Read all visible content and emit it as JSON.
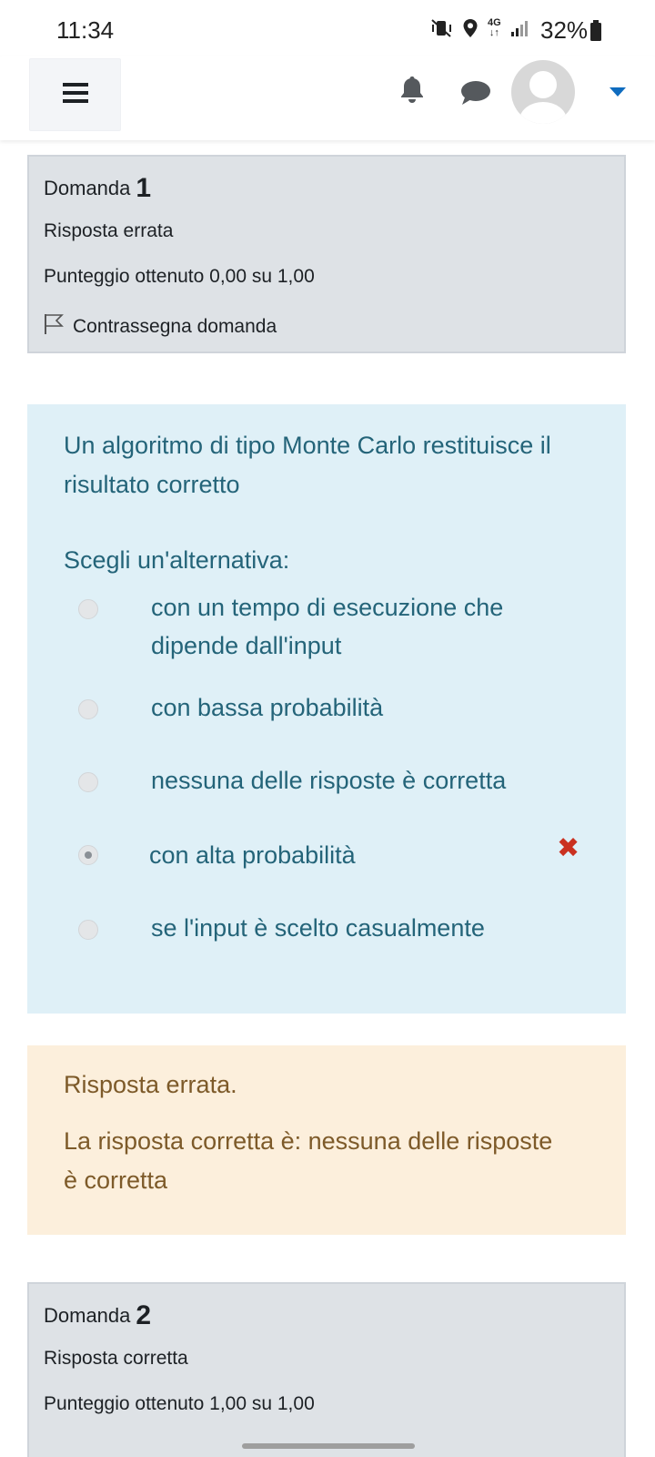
{
  "status_bar": {
    "time": "11:34",
    "network": "4G",
    "battery": "32%",
    "icons": [
      "mute-vibrate-icon",
      "location-icon",
      "data-4g-icon",
      "signal-icon",
      "battery-icon"
    ]
  },
  "navbar": {
    "icons": [
      "menu-icon",
      "bell-icon",
      "chat-icon",
      "avatar",
      "caret-down-icon"
    ],
    "accent": "#0f6cbf"
  },
  "question1": {
    "label": "Domanda",
    "number": "1",
    "state": "Risposta errata",
    "grade": "Punteggio ottenuto 0,00 su 1,00",
    "flag_label": "Contrassegna domanda"
  },
  "content": {
    "question_text": "Un algoritmo di tipo Monte Carlo restituisce il risultato corretto",
    "prompt": "Scegli un'alternativa:",
    "options": [
      {
        "label": "con un tempo di esecuzione che dipende dall'input",
        "selected": false
      },
      {
        "label": "con bassa probabilità",
        "selected": false
      },
      {
        "label": "nessuna delle risposte è corretta",
        "selected": false
      },
      {
        "label": "con alta probabilità",
        "selected": true,
        "mark": "incorrect"
      },
      {
        "label": "se l'input è scelto casualmente",
        "selected": false
      }
    ],
    "colors": {
      "background": "#dff0f7",
      "text": "#246479",
      "incorrect": "#ca3120"
    }
  },
  "feedback": {
    "state": "Risposta errata.",
    "right_answer": "La risposta corretta è: nessuna delle risposte è corretta",
    "colors": {
      "background": "#fcefdc",
      "text": "#7d5a29"
    }
  },
  "question2": {
    "label": "Domanda",
    "number": "2",
    "state": "Risposta corretta",
    "grade": "Punteggio ottenuto 1,00 su 1,00"
  }
}
